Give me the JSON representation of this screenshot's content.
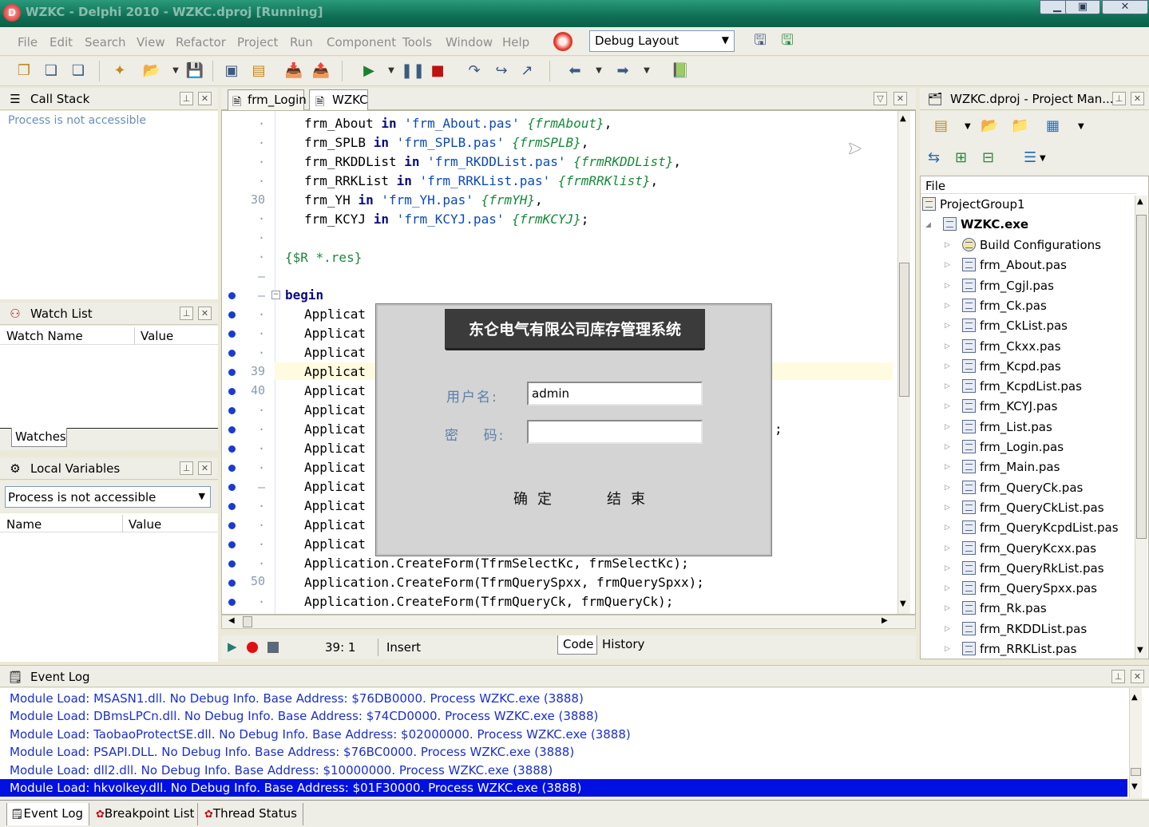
{
  "window": {
    "title": "WZKC - Delphi 2010 - WZKC.dproj [Running]"
  },
  "menu": [
    "File",
    "Edit",
    "Search",
    "View",
    "Refactor",
    "Project",
    "Run",
    "Component",
    "Tools",
    "Window",
    "Help"
  ],
  "layout_select": {
    "value": "Debug Layout"
  },
  "call_stack": {
    "title": "Call Stack",
    "message": "Process is not accessible"
  },
  "watch_list": {
    "title": "Watch List",
    "col_name": "Watch Name",
    "col_value": "Value",
    "tab": "Watches"
  },
  "local_vars": {
    "title": "Local Variables",
    "select_value": "Process is not accessible",
    "col_name": "Name",
    "col_value": "Value"
  },
  "editor": {
    "tabs": [
      "frm_Login",
      "WZKC"
    ],
    "line_numbers": {
      "30": "30",
      "39": "39",
      "40": "40",
      "50": "50"
    },
    "lines": {
      "l1": {
        "id": "frm_About ",
        "kw": "in",
        "str": " 'frm_About.pas' ",
        "cm": "{frmAbout}",
        "end": ","
      },
      "l2": {
        "id": "frm_SPLB ",
        "kw": "in",
        "str": " 'frm_SPLB.pas' ",
        "cm": "{frmSPLB}",
        "end": ","
      },
      "l3": {
        "id": "frm_RKDDList ",
        "kw": "in",
        "str": " 'frm_RKDDList.pas' ",
        "cm": "{frmRKDDList}",
        "end": ","
      },
      "l4": {
        "id": "frm_RRKList ",
        "kw": "in",
        "str": " 'frm_RRKList.pas' ",
        "cm": "{frmRRKlist}",
        "end": ","
      },
      "l5": {
        "id": "frm_YH ",
        "kw": "in",
        "str": " 'frm_YH.pas' ",
        "cm": "{frmYH}",
        "end": ","
      },
      "l6": {
        "id": "frm_KCYJ ",
        "kw": "in",
        "str": " 'frm_KCYJ.pas' ",
        "cm": "{frmKCYJ}",
        "end": ";"
      },
      "res": "{$R *.res}",
      "begin": "begin",
      "app": "Applicat",
      "semi": ";",
      "c1": "Application.CreateForm(TfrmSelectKc, frmSelectKc);",
      "c2": "Application.CreateForm(TfrmQuerySpxx, frmQuerySpxx);",
      "c3": "Application.CreateForm(TfrmQueryCk, frmQueryCk);"
    },
    "status": {
      "position": "39:  1",
      "mode": "Insert",
      "tab_code": "Code",
      "tab_history": "History"
    }
  },
  "dialog": {
    "title": "东仑电气有限公司库存管理系统",
    "user_label": "用户名:",
    "password_label": "密    码:",
    "user_value": "admin",
    "password_value": "",
    "ok": "确定",
    "exit": "结束"
  },
  "project_manager": {
    "title": "WZKC.dproj - Project Man...",
    "header": "File",
    "group": "ProjectGroup1",
    "project": "WZKC.exe",
    "build": "Build Configurations",
    "files": [
      "frm_About.pas",
      "frm_Cgjl.pas",
      "frm_Ck.pas",
      "frm_CkList.pas",
      "frm_Ckxx.pas",
      "frm_Kcpd.pas",
      "frm_KcpdList.pas",
      "frm_KCYJ.pas",
      "frm_List.pas",
      "frm_Login.pas",
      "frm_Main.pas",
      "frm_QueryCk.pas",
      "frm_QueryCkList.pas",
      "frm_QueryKcpdList.pas",
      "frm_QueryKcxx.pas",
      "frm_QueryRkList.pas",
      "frm_QuerySpxx.pas",
      "frm_Rk.pas",
      "frm_RKDDList.pas",
      "frm_RRKList.pas"
    ]
  },
  "event_log": {
    "title": "Event Log",
    "lines": [
      "Module Load: MSASN1.dll. No Debug Info. Base Address: $76DB0000. Process WZKC.exe (3888)",
      "Module Load: DBmsLPCn.dll. No Debug Info. Base Address: $74CD0000. Process WZKC.exe (3888)",
      "Module Load: TaobaoProtectSE.dll. No Debug Info. Base Address: $02000000. Process WZKC.exe (3888)",
      "Module Load: PSAPI.DLL. No Debug Info. Base Address: $76BC0000. Process WZKC.exe (3888)",
      "Module Load: dll2.dll. No Debug Info. Base Address: $10000000. Process WZKC.exe (3888)",
      "Module Load: hkvolkey.dll. No Debug Info. Base Address: $01F30000. Process WZKC.exe (3888)"
    ]
  },
  "bottom_tabs": [
    "Event Log",
    "Breakpoint List",
    "Thread Status"
  ]
}
